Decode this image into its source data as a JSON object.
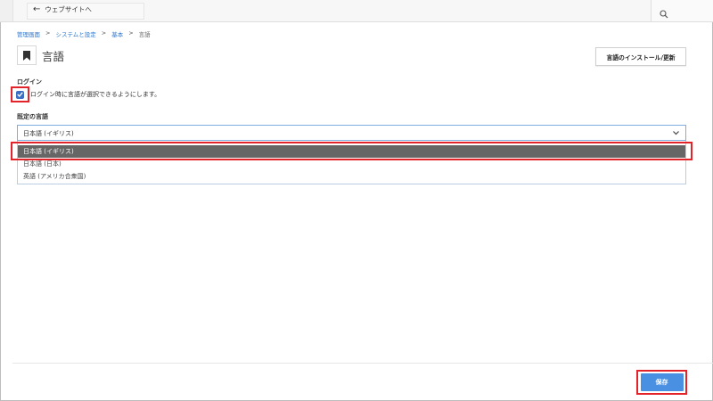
{
  "topbar": {
    "back_label": "ウェブサイトへ"
  },
  "breadcrumb": {
    "items": [
      "管理画面",
      "システムと設定",
      "基本",
      "言語"
    ],
    "separator": ">"
  },
  "page": {
    "title": "言語",
    "title_icon": "bookmark-icon"
  },
  "toolbar": {
    "install_label": "言語のインストール/更新"
  },
  "login": {
    "section_label": "ログイン",
    "checkbox_label": "ログイン時に言語が選択できるようにします。",
    "checked": true
  },
  "default_language": {
    "section_label": "既定の言語",
    "selected_value": "日本語 (イギリス)",
    "options": [
      "日本語 (イギリス)",
      "日本語 (日本)",
      "英語 (アメリカ合衆国)"
    ]
  },
  "footer": {
    "save_label": "保存"
  },
  "colors": {
    "accent": "#4a90e2",
    "highlight": "#e2232a",
    "selected_option": "#666666",
    "link": "#2f76c9"
  }
}
